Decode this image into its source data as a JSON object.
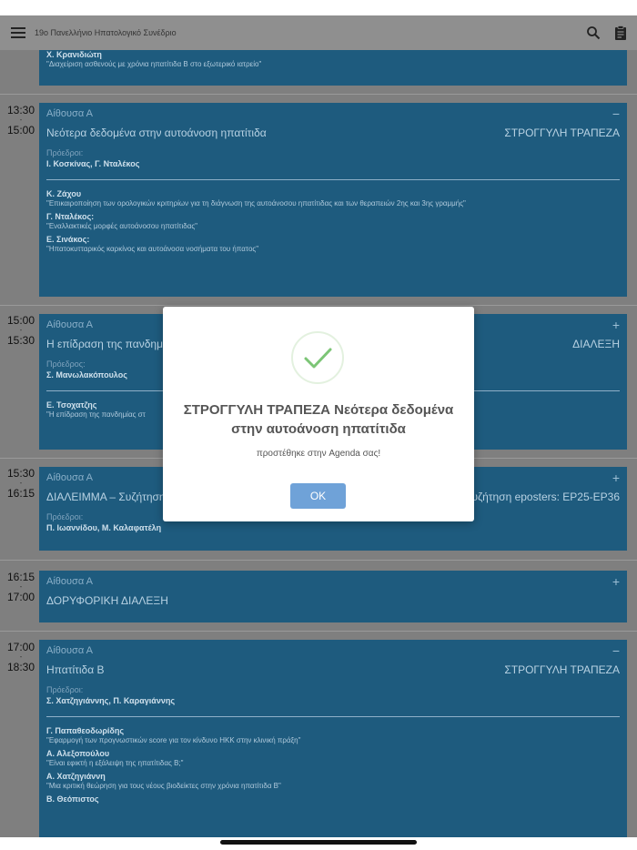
{
  "header": {
    "title": "19ο Πανελλήνιο Ηπατολογικό Συνέδριο"
  },
  "sessions": [
    {
      "speakers": [
        {
          "name": "Χ. Κρανιδιώτη",
          "talk": "\"Διαχείριση ασθενούς με χρόνια ηπατίτιδα Β στο εξωτερικό ιατρείο\""
        }
      ]
    },
    {
      "start": "13:30",
      "end": "15:00",
      "room": "Αίθουσα Α",
      "toggle": "−",
      "title": "Νεότερα δεδομένα στην αυτοάνοση ηπατίτιδα",
      "type": "ΣΤΡΟΓΓΥΛΗ ΤΡΑΠΕΖΑ",
      "chair_label": "Πρόεδροι:",
      "chairs": "Ι. Κοσκίνας, Γ. Νταλέκος",
      "speakers": [
        {
          "name": "Κ. Ζάχου",
          "talk": "\"Επικαιροποίηση των ορολογικών κριτηρίων για τη διάγνωση της αυτοάνοσου ηπατίτιδας και των θεραπειών 2ης και 3ης γραμμής\""
        },
        {
          "name": "Γ. Νταλέκος:",
          "talk": "\"Εναλλακτικές μορφές αυτοάνοσου ηπατίτιδας\""
        },
        {
          "name": "Ε. Σινάκος:",
          "talk": "\"Ηπατοκυτταρικός καρκίνος και αυτοάνοσα νοσήματα του ήπατος\""
        }
      ]
    },
    {
      "start": "15:00",
      "end": "15:30",
      "room": "Αίθουσα Α",
      "toggle": "+",
      "title": "Η επίδραση της πανδημίας",
      "type": "ΔΙΑΛΕΞΗ",
      "chair_label": "Πρόεδρος:",
      "chairs": "Σ. Μανωλακόπουλος",
      "speakers": [
        {
          "name": "Ε. Τσοχατζης",
          "talk": "\"Η επίδραση της πανδημίας στ"
        }
      ]
    },
    {
      "start": "15:30",
      "end": "16:15",
      "room": "Αίθουσα Α",
      "toggle": "+",
      "title": "ΔΙΑΛΕΙΜΜΑ – Συζήτηση ε",
      "type": "Συζήτηση eposters: EP25-EP36",
      "chair_label": "Πρόεδροι:",
      "chairs": "Π. Ιωαννίδου, Μ. Καλαφατέλη"
    },
    {
      "start": "16:15",
      "end": "17:00",
      "room": "Αίθουσα Α",
      "toggle": "+",
      "title": "ΔΟΡΥΦΟΡΙΚΗ ΔΙΑΛΕΞΗ"
    },
    {
      "start": "17:00",
      "end": "18:30",
      "room": "Αίθουσα Α",
      "toggle": "−",
      "title": "Ηπατίτιδα Β",
      "type": "ΣΤΡΟΓΓΥΛΗ ΤΡΑΠΕΖΑ",
      "chair_label": "Πρόεδροι:",
      "chairs": "Σ. Χατζηγιάννης, Π. Καραγιάννης",
      "speakers": [
        {
          "name": "Γ. Παπαθεοδωρίδης",
          "talk": "\"Εφαρμογή των προγνωστικών score για τον κίνδυνο ΗΚΚ στην κλινική πράξη\""
        },
        {
          "name": "Α. Αλεξοπούλου",
          "talk": "\"Είναι εφικτή η εξάλειψη της ηπατίτιδας Β;\""
        },
        {
          "name": "Α. Χατζηγιάννη",
          "talk": "\"Μια κριτική θεώρηση για τους νέους βιοδείκτες στην χρόνια ηπατίτιδα Β\""
        },
        {
          "name": "Β. Θεόπιστος"
        }
      ]
    }
  ],
  "dialog": {
    "title": "ΣΤΡΟΓΓΥΛΗ ΤΡΑΠΕΖΑ Νεότερα δεδομένα στην αυτοάνοση ηπατίτιδα",
    "message": "προστέθηκε στην Agenda σας!",
    "ok_label": "OK"
  },
  "colors": {
    "card": "#1e5b7e",
    "ok_button": "#6fa2d8",
    "check": "#7cc576"
  }
}
